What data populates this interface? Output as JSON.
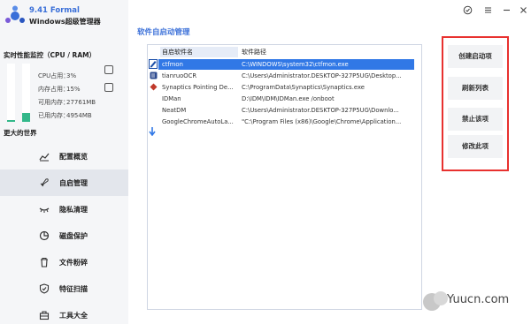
{
  "app": {
    "version_title": "9.41 Formal",
    "product_name": "Windows超级管理器"
  },
  "monitor": {
    "title": "实时性能监控（CPU / RAM）",
    "cpu_usage_percent": 3,
    "ram_usage_percent": 15,
    "stats": [
      {
        "label": "CPU占用：",
        "value": "3%"
      },
      {
        "label": "内存占用：",
        "value": "15%"
      },
      {
        "label": "可用内存：",
        "value": "27761MB"
      },
      {
        "label": "已用内存：",
        "value": "4954MB"
      }
    ]
  },
  "sidebar": {
    "section_title": "更大的世界",
    "items": [
      {
        "label": "配置概览",
        "icon": "chart-line-icon"
      },
      {
        "label": "自启管理",
        "icon": "rocket-icon",
        "active": true
      },
      {
        "label": "隐私清理",
        "icon": "eye-closed-icon"
      },
      {
        "label": "磁盘保护",
        "icon": "pie-chart-icon"
      },
      {
        "label": "文件粉碎",
        "icon": "trash-icon"
      },
      {
        "label": "特征扫描",
        "icon": "shield-check-icon"
      },
      {
        "label": "工具大全",
        "icon": "toolbox-icon"
      }
    ]
  },
  "main": {
    "title": "软件自启动管理",
    "table": {
      "columns": [
        "自启软件名",
        "软件路径"
      ],
      "rows": [
        {
          "name": "ctfmon",
          "path": "C:\\WINDOWS\\system32\\ctfmon.exe",
          "selected": true
        },
        {
          "name": "tianruoOCR",
          "path": "C:\\Users\\Administrator.DESKTOP-327P5UG\\Desktop..."
        },
        {
          "name": "Synaptics Pointing De...",
          "path": "C:\\ProgramData\\Synaptics\\Synaptics.exe"
        },
        {
          "name": "IDMan",
          "path": "D:\\IDM\\IDM\\IDMan.exe /onboot"
        },
        {
          "name": "NeatDM",
          "path": "C:\\Users\\Administrator.DESKTOP-327P5UG\\Downlo..."
        },
        {
          "name": "GoogleChromeAutoLa...",
          "path": "\"C:\\Program Files (x86)\\Google\\Chrome\\Application..."
        }
      ]
    }
  },
  "actions": {
    "buttons": [
      "创建启动项",
      "刷新列表",
      "禁止该项",
      "修改此项"
    ]
  },
  "watermark": {
    "text": "Yuucn.com"
  },
  "colors": {
    "accent": "#3a6fd8",
    "selection": "#3178e6",
    "usage_bar": "#33b88a",
    "highlight_border": "#e8312f"
  }
}
